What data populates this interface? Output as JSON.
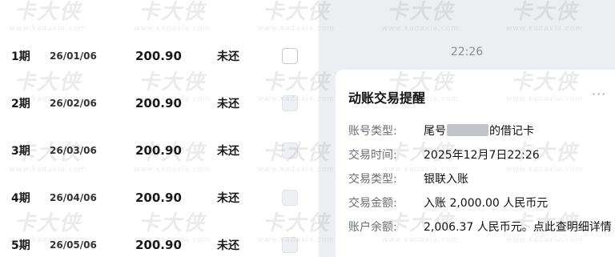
{
  "installments": [
    {
      "period": "1期",
      "date": "26/01/06",
      "amount": "200.90",
      "status": "未还",
      "checkbox_state": "unchecked"
    },
    {
      "period": "2期",
      "date": "26/02/06",
      "amount": "200.90",
      "status": "未还",
      "checkbox_state": "disabled"
    },
    {
      "period": "3期",
      "date": "26/03/06",
      "amount": "200.90",
      "status": "未还",
      "checkbox_state": "disabled"
    },
    {
      "period": "4期",
      "date": "26/04/06",
      "amount": "200.90",
      "status": "未还",
      "checkbox_state": "disabled"
    },
    {
      "period": "5期",
      "date": "26/05/06",
      "amount": "200.90",
      "status": "未还",
      "checkbox_state": "disabled"
    }
  ],
  "chat": {
    "timestamp": "22:26",
    "card": {
      "title": "动账交易提醒",
      "more_icon": "more-dots-icon",
      "fields": [
        {
          "label": "账号类型:",
          "value_prefix": "尾号",
          "value_suffix": "的借记卡",
          "masked": true
        },
        {
          "label": "交易时间:",
          "value": "2025年12月7日22:26"
        },
        {
          "label": "交易类型:",
          "value": "银联入账"
        },
        {
          "label": "交易金额:",
          "value": "入账 2,000.00 人民币元"
        },
        {
          "label": "账户余额:",
          "value": "2,006.37 人民币元。点此查明细详情"
        }
      ]
    }
  },
  "watermark": {
    "text": "卡大侠",
    "url": "www.kadaxia.com"
  },
  "colors": {
    "panel_bg": "#eceef1",
    "card_bg": "#ffffff",
    "label": "#6b6e74",
    "time": "#8a8d93"
  }
}
